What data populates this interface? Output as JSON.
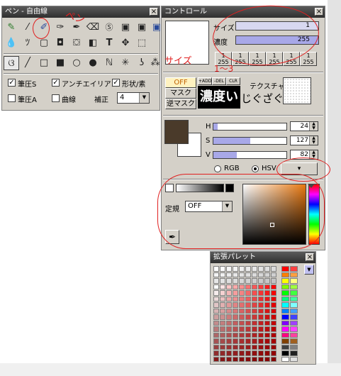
{
  "pen_window": {
    "title": "ペン - 自由線",
    "close": "×",
    "checkboxes": [
      {
        "label": "筆圧S",
        "checked": true
      },
      {
        "label": "アンチエイリアス",
        "checked": true
      },
      {
        "label": "形状/素",
        "checked": true
      },
      {
        "label": "筆圧A",
        "checked": false
      },
      {
        "label": "曲線",
        "checked": false
      }
    ],
    "correction_label": "補正",
    "correction_value": "4"
  },
  "control_window": {
    "title": "コントロール",
    "close": "×",
    "size_label": "サイズ",
    "size_value": "1",
    "density_label": "濃度",
    "density_value": "255",
    "presets": [
      {
        "top": "1",
        "bottom": "255"
      },
      {
        "top": "1",
        "bottom": "255"
      },
      {
        "top": "1",
        "bottom": "255"
      },
      {
        "top": "1",
        "bottom": "255"
      },
      {
        "top": "1",
        "bottom": "255"
      },
      {
        "top": "1",
        "bottom": "255"
      }
    ],
    "mask_off": "OFF",
    "mask": "マスク",
    "reverse_mask": "逆マスク",
    "add_btn": "+ADD",
    "del_btn": "-DEL",
    "clr_btn": "CLR",
    "texture_label": "テクスチャ",
    "h_label": "H",
    "h_value": "24",
    "s_label": "S",
    "s_value": "127",
    "v_label": "V",
    "v_value": "82",
    "rgb_label": "RGB",
    "hsv_label": "HSV",
    "expand_btn": "▾",
    "mode_label": "定規",
    "mode_value": "OFF",
    "fg_color": "#4a3a2a",
    "bg_color": "#ffffff"
  },
  "palette_window": {
    "title": "拡張パレット",
    "close": "×"
  },
  "annotations": {
    "pen_note": "ペン",
    "size_note": "サイズ",
    "size_num": "1〜3",
    "density_note": "濃度い",
    "jiguzagu": "じぐざぐ"
  },
  "colors": {
    "title_bar": "#3c3c3c",
    "window_bg": "#d4d0c8",
    "annotation_red": "#e02020",
    "slider_fill": "#a8a8e8"
  }
}
